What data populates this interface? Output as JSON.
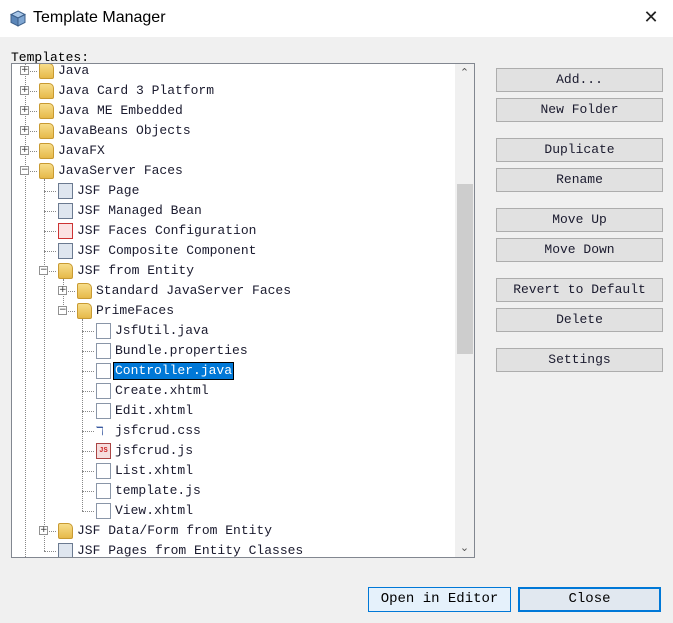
{
  "window": {
    "title": "Template Manager"
  },
  "tree_label": "Templates:",
  "tree": [
    {
      "label": "Java",
      "level": 0,
      "icon": "folder",
      "expander": "plus"
    },
    {
      "label": "Java Card 3 Platform",
      "level": 0,
      "icon": "folder",
      "expander": "plus"
    },
    {
      "label": "Java ME Embedded",
      "level": 0,
      "icon": "folder",
      "expander": "plus"
    },
    {
      "label": "JavaBeans Objects",
      "level": 0,
      "icon": "folder",
      "expander": "plus"
    },
    {
      "label": "JavaFX",
      "level": 0,
      "icon": "folder",
      "expander": "plus"
    },
    {
      "label": "JavaServer Faces",
      "level": 0,
      "icon": "folder",
      "expander": "minus"
    },
    {
      "label": "JSF Page",
      "level": 1,
      "icon": "jsf-page"
    },
    {
      "label": "JSF Managed Bean",
      "level": 1,
      "icon": "jsf-bean"
    },
    {
      "label": "JSF Faces Configuration",
      "level": 1,
      "icon": "jsf-config"
    },
    {
      "label": "JSF Composite Component",
      "level": 1,
      "icon": "jsf-composite"
    },
    {
      "label": "JSF from Entity",
      "level": 1,
      "icon": "folder",
      "expander": "minus"
    },
    {
      "label": "Standard JavaServer Faces",
      "level": 2,
      "icon": "folder",
      "expander": "plus"
    },
    {
      "label": "PrimeFaces",
      "level": 2,
      "icon": "folder",
      "expander": "minus"
    },
    {
      "label": "JsfUtil.java",
      "level": 3,
      "icon": "file"
    },
    {
      "label": "Bundle.properties",
      "level": 3,
      "icon": "file"
    },
    {
      "label": "Controller.java",
      "level": 3,
      "icon": "file",
      "selected": true
    },
    {
      "label": "Create.xhtml",
      "level": 3,
      "icon": "file"
    },
    {
      "label": "Edit.xhtml",
      "level": 3,
      "icon": "file"
    },
    {
      "label": "jsfcrud.css",
      "level": 3,
      "icon": "css"
    },
    {
      "label": "jsfcrud.js",
      "level": 3,
      "icon": "js"
    },
    {
      "label": "List.xhtml",
      "level": 3,
      "icon": "file"
    },
    {
      "label": "template.js",
      "level": 3,
      "icon": "file"
    },
    {
      "label": "View.xhtml",
      "level": 3,
      "icon": "file"
    },
    {
      "label": "JSF Data/Form from Entity",
      "level": 1,
      "icon": "folder",
      "expander": "plus"
    },
    {
      "label": "JSF Pages from Entity Classes",
      "level": 1,
      "icon": "jsf-page"
    }
  ],
  "buttons": [
    {
      "id": "add",
      "label": "Add..."
    },
    {
      "id": "new-folder",
      "label": "New Folder"
    },
    {
      "id": "duplicate",
      "label": "Duplicate"
    },
    {
      "id": "rename",
      "label": "Rename"
    },
    {
      "id": "move-up",
      "label": "Move Up"
    },
    {
      "id": "move-down",
      "label": "Move Down"
    },
    {
      "id": "revert-to-default",
      "label": "Revert to Default"
    },
    {
      "id": "delete",
      "label": "Delete"
    },
    {
      "id": "settings",
      "label": "Settings"
    }
  ],
  "footer": {
    "open_in_editor": "Open in Editor",
    "close": "Close"
  },
  "colors": {
    "selection": "#0078d7",
    "dialog_bg": "#f0f0f0"
  }
}
